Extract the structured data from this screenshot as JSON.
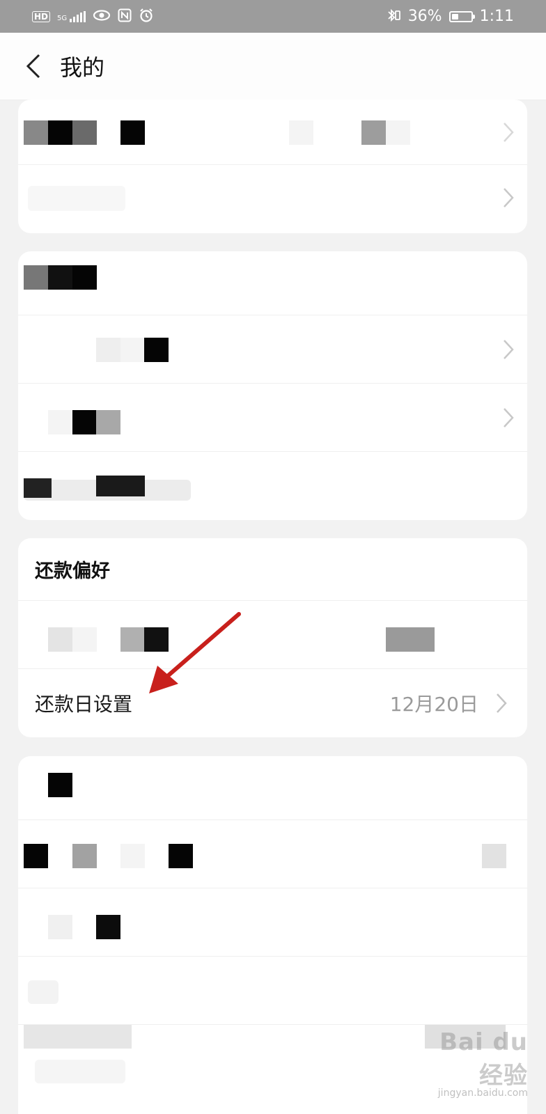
{
  "status_bar": {
    "left_icons": [
      "hd-icon",
      "5g-signal-icon",
      "eye-icon",
      "nfc-icon",
      "alarm-icon"
    ],
    "hd": "HD",
    "network": "5G",
    "battery_percent": "36%",
    "battery_level": 0.36,
    "time": "1:11"
  },
  "header": {
    "title": "我的"
  },
  "repayment_card": {
    "section_title": "还款偏好",
    "day_setting_label": "还款日设置",
    "day_setting_value": "12月20日"
  },
  "watermark": {
    "main": "Bai du 经验",
    "sub": "jingyan.baidu.com"
  },
  "colors": {
    "status_bar_bg": "#9c9c9c",
    "page_bg": "#f2f2f2",
    "annotation_arrow": "#c8201c",
    "secondary_text": "#9a9a9a"
  }
}
